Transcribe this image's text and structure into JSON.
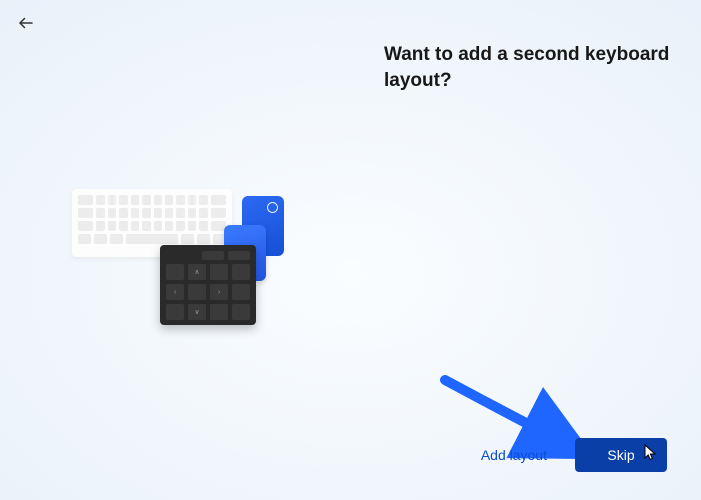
{
  "back_label": "Back",
  "heading": "Want to add a second keyboard layout?",
  "buttons": {
    "add_layout": "Add layout",
    "skip": "Skip"
  },
  "colors": {
    "primary_button": "#0a3fa8",
    "link": "#0b4dd0",
    "annotation_arrow": "#1e66ff"
  }
}
